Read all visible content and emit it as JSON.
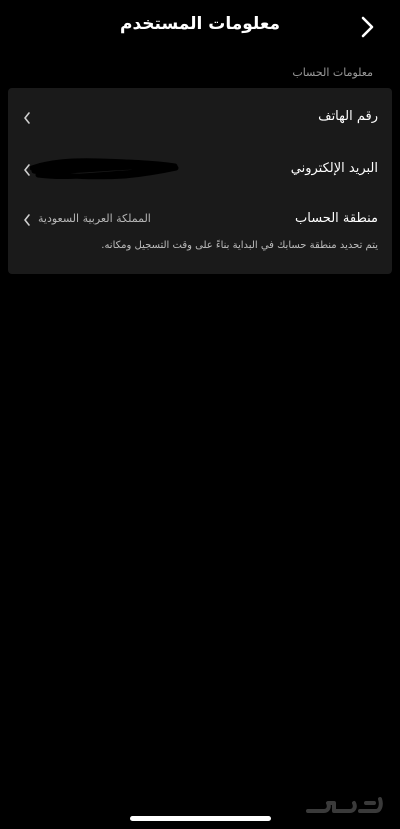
{
  "header": {
    "title": "معلومات المستخدم",
    "back_icon": "chevron-right-icon"
  },
  "section": {
    "label": "معلومات الحساب"
  },
  "rows": [
    {
      "label": "رقم الهاتف",
      "value": "",
      "icon": "chevron-left-icon"
    },
    {
      "label": "البريد الإلكتروني",
      "value": "",
      "icon": "chevron-left-icon",
      "value_redacted": true
    },
    {
      "label": "منطقة الحساب",
      "value": "المملكة العربية السعودية",
      "icon": "chevron-left-icon"
    }
  ],
  "region_note": "يتم تحديد منطقة حسابك في البداية بناءً على وقت التسجيل ومكانه.",
  "watermark": {
    "text": "حراج"
  },
  "colors": {
    "background": "#000000",
    "card": "#1a1a1a",
    "text": "#ffffff",
    "muted": "#9a9a9a"
  }
}
